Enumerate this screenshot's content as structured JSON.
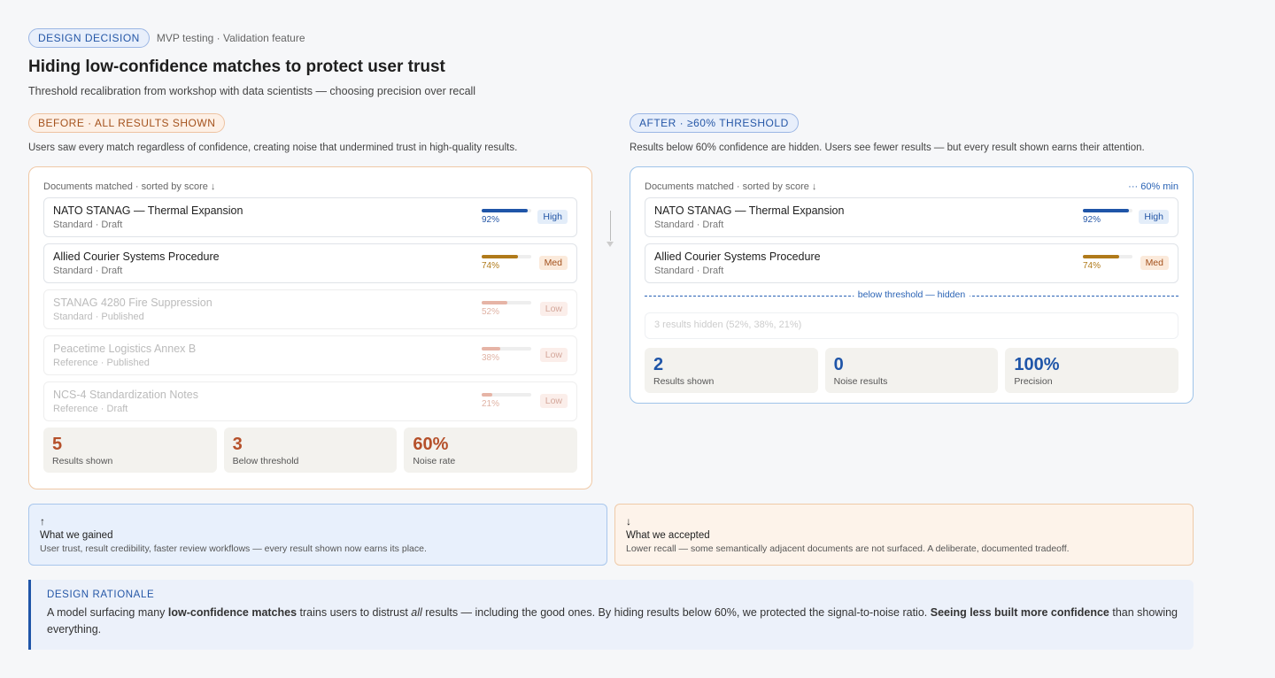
{
  "header": {
    "tag": "DESIGN DECISION",
    "tag_sub": "MVP testing · Validation feature",
    "title": "Hiding low-confidence matches to protect user trust",
    "subtitle": "Threshold recalibration from workshop with data scientists — choosing precision over recall"
  },
  "before": {
    "tag": "BEFORE · ALL RESULTS SHOWN",
    "desc": "Users saw every match regardless of confidence, creating noise that undermined trust in high-quality results.",
    "list_label": "Documents matched · sorted by score ↓",
    "rows": [
      {
        "title": "NATO STANAG — Thermal Expansion",
        "meta": "Standard · Draft",
        "pct": "92%",
        "score": 0.92,
        "badge": "High",
        "color": "#1f55a8"
      },
      {
        "title": "Allied Courier Systems Procedure",
        "meta": "Standard · Draft",
        "pct": "74%",
        "score": 0.74,
        "badge": "Med",
        "color": "#b07a1a"
      },
      {
        "title": "STANAG 4280 Fire Suppression",
        "meta": "Standard · Published",
        "pct": "52%",
        "score": 0.52,
        "badge": "Low",
        "color": "#e6b4a6"
      },
      {
        "title": "Peacetime Logistics Annex B",
        "meta": "Reference · Published",
        "pct": "38%",
        "score": 0.38,
        "badge": "Low",
        "color": "#e6b4a6"
      },
      {
        "title": "NCS-4 Standardization Notes",
        "meta": "Reference · Draft",
        "pct": "21%",
        "score": 0.21,
        "badge": "Low",
        "color": "#e6b4a6"
      }
    ],
    "stats": [
      {
        "num": "5",
        "label": "Results shown"
      },
      {
        "num": "3",
        "label": "Below threshold"
      },
      {
        "num": "60%",
        "label": "Noise rate"
      }
    ]
  },
  "after": {
    "tag": "AFTER · ≥60% THRESHOLD",
    "desc": "Results below 60% confidence are hidden. Users see fewer results — but every result shown earns their attention.",
    "list_label": "Documents matched · sorted by score ↓",
    "threshold_label": "··· 60% min",
    "rows": [
      {
        "title": "NATO STANAG — Thermal Expansion",
        "meta": "Standard · Draft",
        "pct": "92%",
        "score": 0.92,
        "badge": "High",
        "color": "#1f55a8"
      },
      {
        "title": "Allied Courier Systems Procedure",
        "meta": "Standard · Draft",
        "pct": "74%",
        "score": 0.74,
        "badge": "Med",
        "color": "#b07a1a"
      }
    ],
    "divider_label": "below threshold — hidden",
    "hidden_text": "3 results hidden (52%, 38%, 21%)",
    "stats": [
      {
        "num": "2",
        "label": "Results shown"
      },
      {
        "num": "0",
        "label": "Noise results"
      },
      {
        "num": "100%",
        "label": "Precision"
      }
    ]
  },
  "gained": {
    "icon": "↑",
    "title": "What we gained",
    "desc": "User trust, result credibility, faster review workflows — every result shown now earns its place."
  },
  "accepted": {
    "icon": "↓",
    "title": "What we accepted",
    "desc": "Lower recall — some semantically adjacent documents are not surfaced. A deliberate, documented tradeoff."
  },
  "rationale": {
    "title": "DESIGN RATIONALE",
    "p1": "A model surfacing many ",
    "b1": "low-confidence matches",
    "p2": " trains users to distrust ",
    "i1": "all",
    "p3": " results — including the good ones. By hiding results below 60%, we protected the signal-to-noise ratio. ",
    "b2": "Seeing less built more confidence",
    "p4": " than showing everything."
  }
}
